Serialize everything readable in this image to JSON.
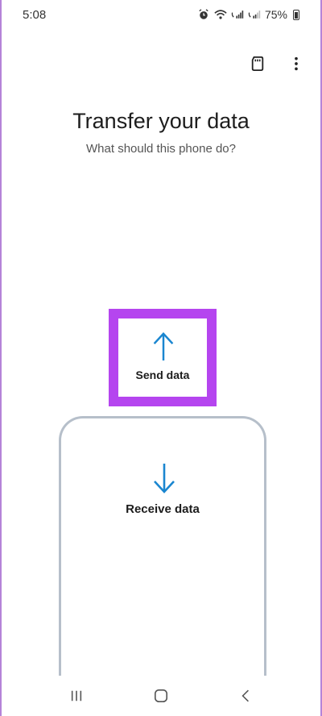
{
  "status_bar": {
    "time": "5:08",
    "battery_percent": "75%",
    "icons": [
      "alarm-icon",
      "wifi-icon",
      "volte-signal-icon",
      "volte-signal-icon",
      "battery-icon"
    ]
  },
  "toolbar": {
    "icons": [
      "sd-card-icon",
      "more-options-icon"
    ]
  },
  "header": {
    "title": "Transfer your data",
    "subtitle": "What should this phone do?"
  },
  "options": {
    "send": {
      "label": "Send data",
      "icon": "arrow-up-icon"
    },
    "receive": {
      "label": "Receive data",
      "icon": "arrow-down-icon"
    }
  },
  "nav_bar": {
    "icons": [
      "recents-icon",
      "home-icon",
      "back-icon"
    ]
  },
  "colors": {
    "accent_arrow": "#1a86d0",
    "highlight_border": "#b545ef",
    "card_border": "#b6bfca"
  }
}
